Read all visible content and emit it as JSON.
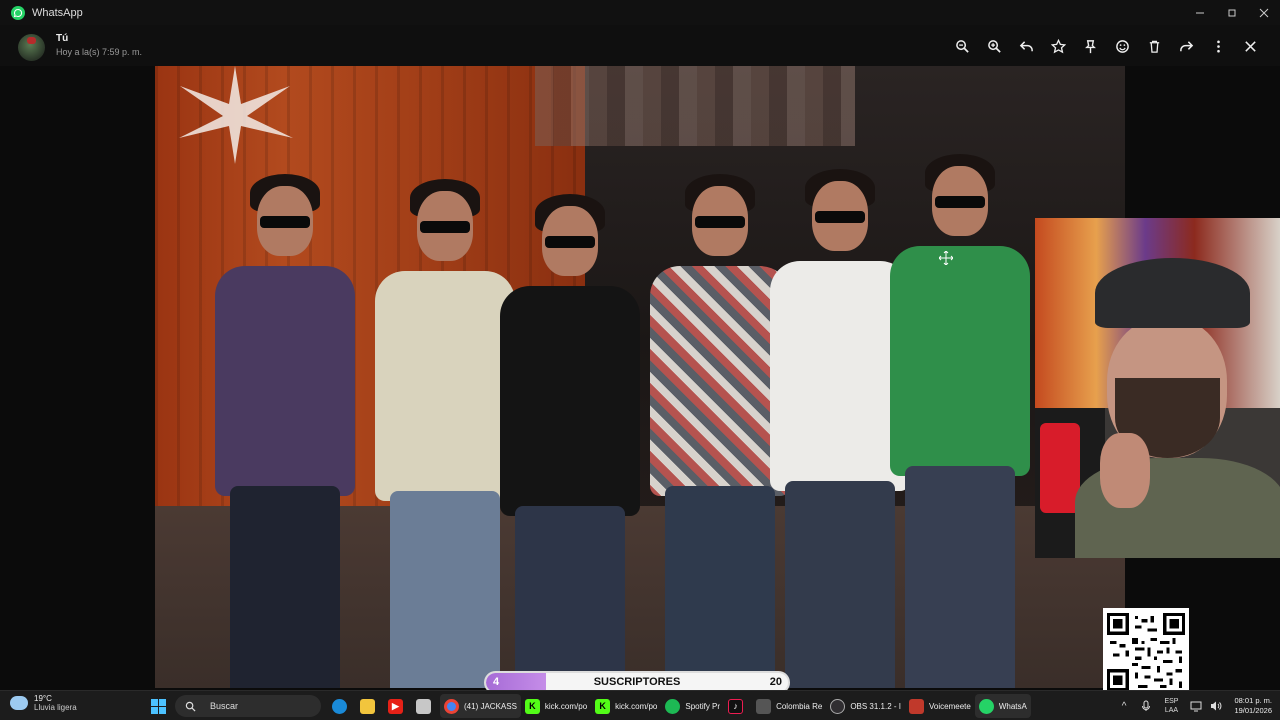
{
  "window": {
    "app_title": "WhatsApp"
  },
  "viewer": {
    "sender": "Tú",
    "time": "Hoy a la(s) 7:59 p. m.",
    "toolbar": [
      "zoom-out",
      "zoom-in",
      "reply",
      "star",
      "pin",
      "react",
      "delete",
      "forward",
      "more",
      "close"
    ]
  },
  "overlay": {
    "subscribers": {
      "label": "SUSCRIPTORES",
      "current": "4",
      "goal": "20",
      "progress": 0.2
    }
  },
  "taskbar": {
    "weather": {
      "temp": "19°C",
      "desc": "Lluvia ligera"
    },
    "search_placeholder": "Buscar",
    "tasks": [
      {
        "label": "(41) JACKASS",
        "icon": "chrome-icon",
        "color": "#4285f4"
      },
      {
        "label": "kick.com/po",
        "icon": "kick-icon",
        "color": "#53fc18"
      },
      {
        "label": "kick.com/po",
        "icon": "kick-icon",
        "color": "#53fc18"
      },
      {
        "label": "Spotify Pr",
        "icon": "spotify-icon",
        "color": "#1db954"
      },
      {
        "label": "Colombia Re",
        "icon": "colombia-icon",
        "color": "#555555"
      },
      {
        "label": "OBS 31.1.2 - I",
        "icon": "obs-icon",
        "color": "#302e31"
      },
      {
        "label": "Voicemeete",
        "icon": "voicemeeter-icon",
        "color": "#c0392b"
      },
      {
        "label": "WhatsA",
        "icon": "whatsapp-icon",
        "color": "#25d366"
      }
    ],
    "tray": {
      "lang1": "ESP",
      "lang2": "LAA",
      "time": "08:01 p. m.",
      "date": "19/01/2026"
    }
  }
}
